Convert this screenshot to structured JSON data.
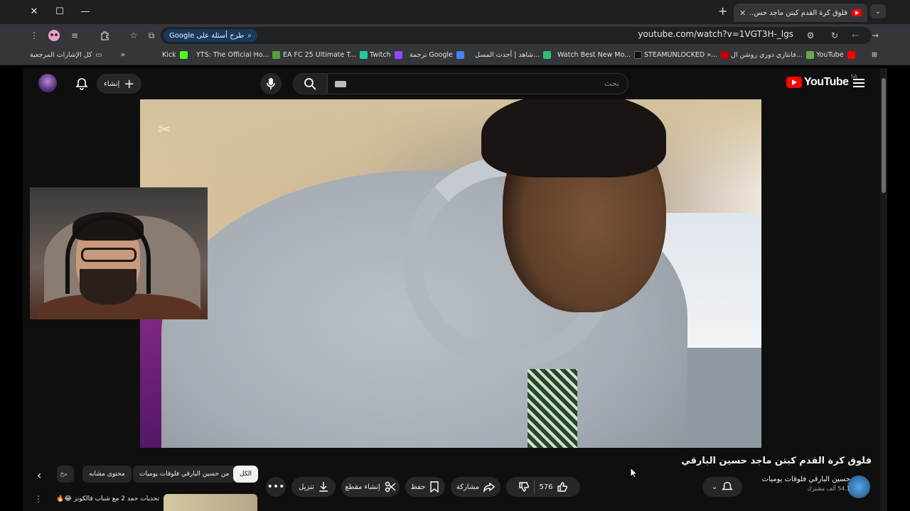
{
  "browser": {
    "tab_title": "فلوق كرة القدم كبتن ماجد حس...",
    "url": "youtube.com/watch?v=1VGT3H-_lgs",
    "ask_chip": "طرح أسئلة على Google",
    "bookmarks": [
      {
        "label": "YouTube",
        "color": "#ff0000"
      },
      {
        "label": "فانتازي دوري روشن ال...",
        "color": "#6aa84f"
      },
      {
        "label": "STEAMUNLOCKED »...",
        "color": "#c00000"
      },
      {
        "label": "Watch Best New Mo...",
        "color": "#111111"
      },
      {
        "label": "شاهد | أحدث المسل...",
        "color": "#2fbf71"
      },
      {
        "label": "ترجمة Google",
        "color": "#4285f4"
      },
      {
        "label": "Twitch",
        "color": "#9146ff"
      },
      {
        "label": "EA FC 25 Ultimate T...",
        "color": "#21c8a0"
      },
      {
        "label": "YTS: The Official Ho...",
        "color": "#5a9e3c"
      },
      {
        "label": "Kick",
        "color": "#53fc18"
      }
    ],
    "all_bookmarks": "كل الإشارات المرجعية"
  },
  "masthead": {
    "logo_text": "YouTube",
    "country_code": "SA",
    "search_placeholder": "بحث",
    "create_label": "إنشاء"
  },
  "video": {
    "title": "فلوق كرة القدم كبتن ماجد حسين البارقي",
    "channel_name": "حسين البارقي فلوقات يوميات",
    "subscribers": "54.1 ألف مشترك",
    "likes": "576",
    "share_label": "مشاركة",
    "save_label": "حفظ",
    "clip_label": "إنشاء مقطع",
    "download_label": "تنزيل"
  },
  "chips": {
    "all": "الكل",
    "from_channel": "من حسين البارقي فلوقات يوميات",
    "related": "محتوى مشابه",
    "more": "مح"
  },
  "recommendation": {
    "title": "تحديات حمد 2 مع شباب فالكونز 😂🔥"
  },
  "colors": {
    "accent": "#ff0000",
    "background": "#0f0f0f",
    "chip_bg": "#272727"
  }
}
